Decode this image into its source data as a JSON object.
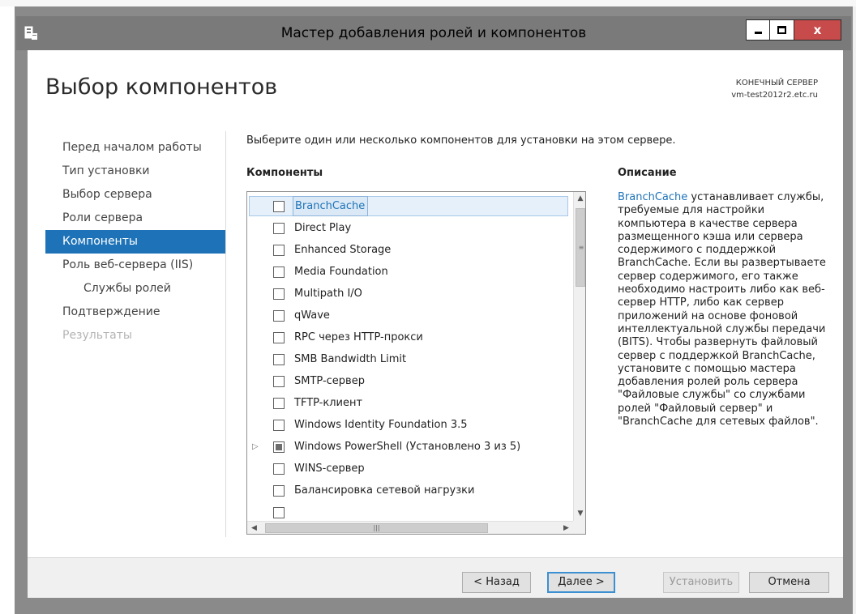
{
  "window": {
    "title": "Мастер добавления ролей и компонентов",
    "close_glyph": "x"
  },
  "page": {
    "title": "Выбор компонентов",
    "destination_label": "КОНЕЧНЫЙ СЕРВЕР",
    "destination_server": "vm-test2012r2.etc.ru"
  },
  "nav": {
    "items": [
      {
        "label": "Перед началом работы",
        "state": "normal"
      },
      {
        "label": "Тип установки",
        "state": "normal"
      },
      {
        "label": "Выбор сервера",
        "state": "normal"
      },
      {
        "label": "Роли сервера",
        "state": "normal"
      },
      {
        "label": "Компоненты",
        "state": "active"
      },
      {
        "label": "Роль веб-сервера (IIS)",
        "state": "normal"
      },
      {
        "label": "Службы ролей",
        "state": "sub"
      },
      {
        "label": "Подтверждение",
        "state": "normal"
      },
      {
        "label": "Результаты",
        "state": "disabled"
      }
    ]
  },
  "main": {
    "instruction": "Выберите один или несколько компонентов для установки на этом сервере.",
    "components_header": "Компоненты",
    "description_header": "Описание",
    "components": [
      {
        "label": "BranchCache",
        "checked": false,
        "selected": true
      },
      {
        "label": "Direct Play",
        "checked": false
      },
      {
        "label": "Enhanced Storage",
        "checked": false
      },
      {
        "label": "Media Foundation",
        "checked": false
      },
      {
        "label": "Multipath I/O",
        "checked": false
      },
      {
        "label": "qWave",
        "checked": false
      },
      {
        "label": "RPC через HTTP-прокси",
        "checked": false
      },
      {
        "label": "SMB Bandwidth Limit",
        "checked": false
      },
      {
        "label": "SMTP-сервер",
        "checked": false
      },
      {
        "label": "TFTP-клиент",
        "checked": false
      },
      {
        "label": "Windows Identity Foundation 3.5",
        "checked": false
      },
      {
        "label": "Windows PowerShell (Установлено 3 из 5)",
        "checked": "partial",
        "expandable": true
      },
      {
        "label": "WINS-сервер",
        "checked": false
      },
      {
        "label": "Балансировка сетевой нагрузки",
        "checked": false
      }
    ],
    "description_link": "BranchCache",
    "description_text": " устанавливает службы, требуемые для настройки компьютера в качестве сервера размещенного кэша или сервера содержимого с поддержкой BranchCache. Если вы развертываете сервер содержимого, его также необходимо настроить либо как веб-сервер HTTP, либо как сервер приложений на основе фоновой интеллектуальной службы передачи (BITS). Чтобы развернуть файловый сервер с поддержкой BranchCache, установите с помощью мастера добавления ролей роль сервера \"Файловые службы\" со службами ролей \"Файловый сервер\" и \"BranchCache для сетевых файлов\"."
  },
  "footer": {
    "back": "< Назад",
    "next": "Далее >",
    "install": "Установить",
    "cancel": "Отмена"
  },
  "colors": {
    "accent": "#1e73b8",
    "close_button": "#c74b4b",
    "titlebar": "#7a7a7a"
  },
  "icons": {
    "app": "server-manager-icon",
    "minimize": "minimize-icon",
    "maximize": "maximize-icon",
    "close": "close-icon"
  }
}
